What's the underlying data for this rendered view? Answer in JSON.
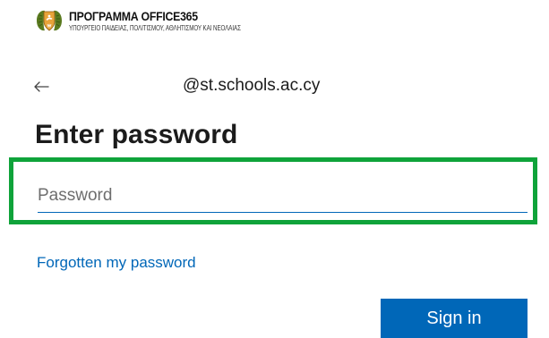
{
  "branding": {
    "title": "ΠΡΟΓΡΑΜΜΑ OFFICE365",
    "subtitle": "ΥΠΟΥΡΓΕΙΟ ΠΑΙΔΕΙΑΣ, ΠΟΛΙΤΙΣΜΟΥ, ΑΘΛΗΤΙΣΜΟΥ ΚΑΙ ΝΕΟΛΑΙΑΣ",
    "emblem_icon": "cyprus-coat-of-arms-icon"
  },
  "identity": {
    "back_icon": "back-arrow-icon",
    "email": "@st.schools.ac.cy"
  },
  "heading": "Enter password",
  "password_field": {
    "placeholder": "Password",
    "value": ""
  },
  "forgot_link": "Forgotten my password",
  "sign_in_button": "Sign in",
  "colors": {
    "accent": "#0067b8",
    "highlight": "#0fa33a",
    "text": "#1b1b1b"
  }
}
